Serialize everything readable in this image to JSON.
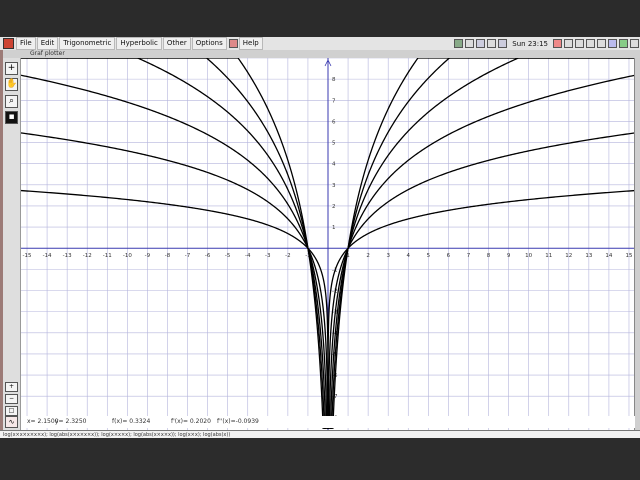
{
  "menu": {
    "items": [
      "File",
      "Edit",
      "Trigonometric",
      "Hyperbolic",
      "Other",
      "Options",
      "Help"
    ],
    "clock": "Sun 23:15"
  },
  "window": {
    "title": "Graf plotter"
  },
  "status": {
    "x": "x= 2.1500",
    "y": "y= 2.3250",
    "fx": "f(x)= 0.3324",
    "f1x": "f'(x)= 0.2020",
    "f2x": "f''(x)=-0.0939"
  },
  "formula_bar": {
    "text": "log(x×x×x×x×x); log(abs(x×x×x×x)); log(x×x×x); log(abs(x×x×x)); log(x×x); log(abs(x))"
  },
  "chart_data": {
    "type": "line",
    "title": "",
    "xlabel": "",
    "ylabel": "",
    "xlim": [
      -15.3,
      15.3
    ],
    "ylim": [
      -8.6,
      9.0
    ],
    "grid": true,
    "x_ticks": [
      -15,
      -14,
      -13,
      -12,
      -11,
      -10,
      -9,
      -8,
      -7,
      -6,
      -5,
      -4,
      -3,
      -2,
      -1,
      1,
      2,
      3,
      4,
      5,
      6,
      7,
      8,
      9,
      10,
      11,
      12,
      13,
      14,
      15
    ],
    "y_ticks": [
      -8,
      -7,
      -6,
      -5,
      -4,
      -3,
      -2,
      -1,
      1,
      2,
      3,
      4,
      5,
      6,
      7,
      8
    ],
    "series": [
      {
        "coefficient": 6
      },
      {
        "coefficient": 5
      },
      {
        "coefficient": 4
      },
      {
        "coefficient": 3
      },
      {
        "coefficient": 2
      },
      {
        "coefficient": 1
      }
    ],
    "function_form": "coefficient * ln(|x|)"
  }
}
